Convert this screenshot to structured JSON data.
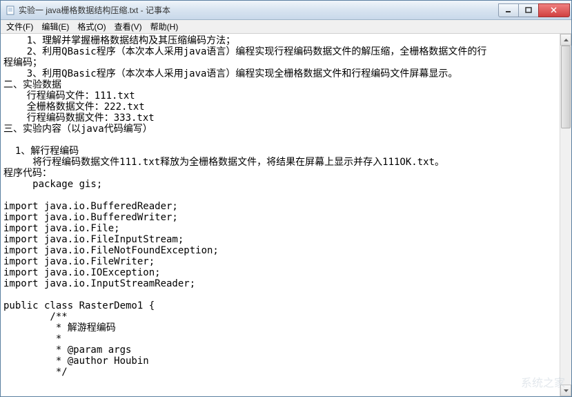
{
  "window": {
    "title": "实验一 java栅格数据结构压缩.txt - 记事本"
  },
  "menu": {
    "file": "文件(F)",
    "edit": "编辑(E)",
    "format": "格式(O)",
    "view": "查看(V)",
    "help": "帮助(H)"
  },
  "content": "    1、理解并掌握栅格数据结构及其压缩编码方法；\n    2、利用QBasic程序（本次本人采用java语言）编程实现行程编码数据文件的解压缩，全栅格数据文件的行\n程编码；\n    3、利用QBasic程序（本次本人采用java语言）编程实现全栅格数据文件和行程编码文件屏幕显示。\n二、实验数据\n    行程编码文件：111.txt\n    全栅格数据文件：222.txt\n    行程编码数据文件：333.txt\n三、实验内容（以java代码编写）\n\n  1、解行程编码\n     将行程编码数据文件111.txt释放为全栅格数据文件，将结果在屏幕上显示并存入111OK.txt。\n程序代码：\n     package gis;\n\nimport java.io.BufferedReader;\nimport java.io.BufferedWriter;\nimport java.io.File;\nimport java.io.FileInputStream;\nimport java.io.FileNotFoundException;\nimport java.io.FileWriter;\nimport java.io.IOException;\nimport java.io.InputStreamReader;\n\npublic class RasterDemo1 {\n        /**\n         * 解游程编码\n         * \n         * @param args\n         * @author Houbin\n         */",
  "watermark": "系统之家"
}
